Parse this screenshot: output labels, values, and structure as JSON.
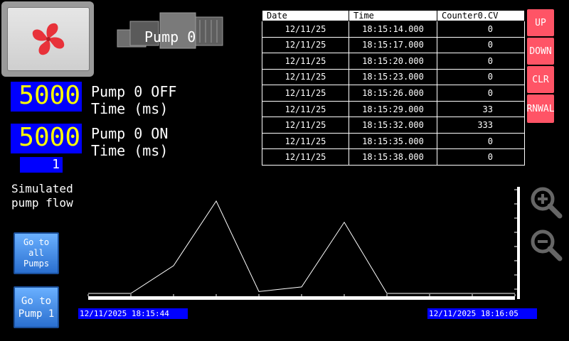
{
  "header": {
    "pump_title": "Pump 0"
  },
  "controls": {
    "off_time": {
      "value": "5000",
      "label_line1": "Pump 0 OFF",
      "label_line2": "Time (ms)"
    },
    "on_time": {
      "value": "5000",
      "label_line1": "Pump 0 ON",
      "label_line2": "Time (ms)"
    },
    "counter_value": "1",
    "sim_label_line1": "Simulated",
    "sim_label_line2": "pump flow"
  },
  "table": {
    "headers": [
      "Date",
      "Time",
      "Counter0.CV"
    ],
    "rows": [
      [
        "12/11/25",
        "18:15:14.000",
        "0"
      ],
      [
        "12/11/25",
        "18:15:17.000",
        "0"
      ],
      [
        "12/11/25",
        "18:15:20.000",
        "0"
      ],
      [
        "12/11/25",
        "18:15:23.000",
        "0"
      ],
      [
        "12/11/25",
        "18:15:26.000",
        "0"
      ],
      [
        "12/11/25",
        "18:15:29.000",
        "33"
      ],
      [
        "12/11/25",
        "18:15:32.000",
        "333"
      ],
      [
        "12/11/25",
        "18:15:35.000",
        "0"
      ],
      [
        "12/11/25",
        "18:15:38.000",
        "0"
      ]
    ]
  },
  "side_buttons": {
    "up": "UP",
    "down": "DOWN",
    "clr": "CLR",
    "rnwal": "RNWAL"
  },
  "nav": {
    "all_pumps": "Go to\nall\nPumps",
    "pump1": "Go to\nPump 1"
  },
  "trend": {
    "start_time": "12/11/2025 18:15:44",
    "end_time": "12/11/2025 18:16:05",
    "values": [
      0,
      0,
      0.3,
      1.0,
      0.02,
      0.07,
      0.77,
      0,
      0,
      0,
      0
    ]
  },
  "colors": {
    "value_bg": "#0000ff",
    "value_text": "#ffff00",
    "side_button": "#ff5466",
    "nav_button": "#3d87e0"
  },
  "icons": {
    "fan": "fan-icon",
    "pump": "pump-icon",
    "zoom_in": "zoom-in-icon",
    "zoom_out": "zoom-out-icon"
  }
}
